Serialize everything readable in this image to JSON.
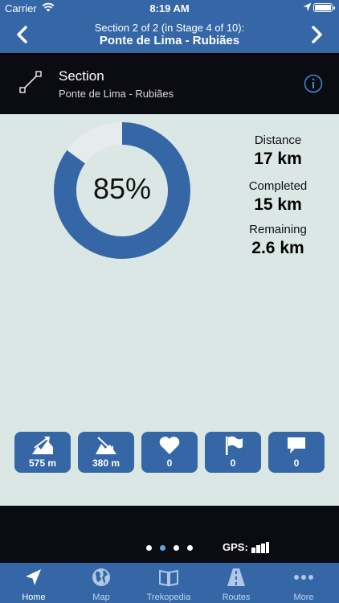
{
  "status_bar": {
    "carrier": "Carrier",
    "time": "8:19 AM"
  },
  "nav": {
    "subtitle": "Section 2 of 2 (in Stage 4 of 10):",
    "title": "Ponte de Lima - Rubiães"
  },
  "section": {
    "title": "Section",
    "subtitle": "Ponte de Lima - Rubiães"
  },
  "progress": {
    "percent_label": "85%",
    "fraction": 0.85
  },
  "stats": {
    "distance_label": "Distance",
    "distance_value": "17 km",
    "completed_label": "Completed",
    "completed_value": "15 km",
    "remaining_label": "Remaining",
    "remaining_value": "2.6 km"
  },
  "tiles": [
    {
      "icon": "ascent-icon",
      "value": "575 m"
    },
    {
      "icon": "descent-icon",
      "value": "380 m"
    },
    {
      "icon": "heart-icon",
      "value": "0"
    },
    {
      "icon": "flag-icon",
      "value": "0"
    },
    {
      "icon": "comment-icon",
      "value": "0"
    }
  ],
  "pager": {
    "count": 4,
    "active_index": 1
  },
  "gps": {
    "label": "GPS:"
  },
  "tabs": [
    {
      "label": "Home",
      "icon": "navigation-arrow-icon",
      "active": true
    },
    {
      "label": "Map",
      "icon": "globe-icon",
      "active": false
    },
    {
      "label": "Trekopedia",
      "icon": "book-icon",
      "active": false
    },
    {
      "label": "Routes",
      "icon": "road-icon",
      "active": false
    },
    {
      "label": "More",
      "icon": "more-dots-icon",
      "active": false
    }
  ],
  "colors": {
    "accent": "#3567a6",
    "background": "#dbe7e5",
    "ring_track": "#e6ecec",
    "dark": "#0b0b12"
  }
}
